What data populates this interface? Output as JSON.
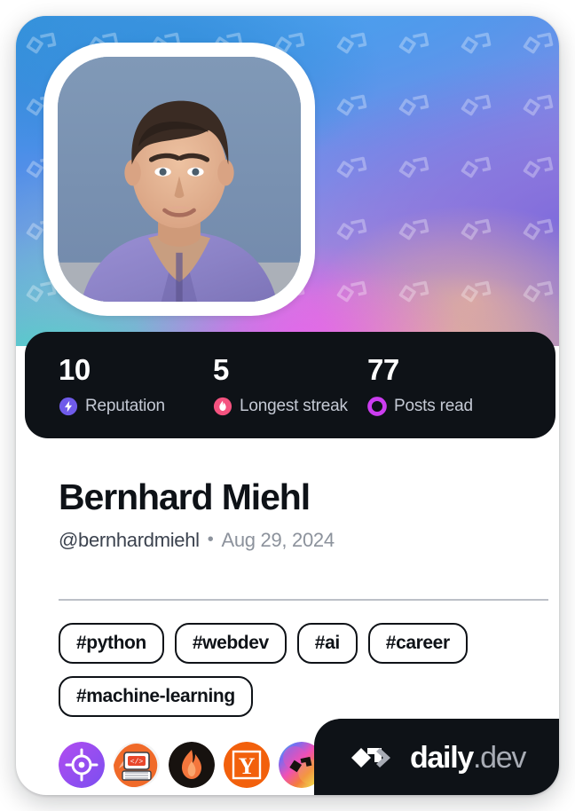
{
  "card": {
    "type": "developer-card",
    "accent_colors": {
      "reputation": "#6f5bea",
      "streak": "#f4527f",
      "posts_read": "#cc3df0",
      "card_dark": "#0e1217",
      "text_primary": "#0e1217",
      "text_muted": "#8c929c"
    }
  },
  "avatar": {
    "alt": "Bernhard Miehl profile photo",
    "shirt_color": "#8d86c9",
    "backdrop_color": "#7b94b4",
    "hair_color": "#3a2b23",
    "skin_color": "#e4b495"
  },
  "stats": [
    {
      "value": "10",
      "label": "Reputation",
      "icon": "bolt-icon",
      "color": "#6f5bea"
    },
    {
      "value": "5",
      "label": "Longest streak",
      "icon": "flame-icon",
      "color": "#f4527f"
    },
    {
      "value": "77",
      "label": "Posts read",
      "icon": "ring-icon",
      "color": "#cc3df0"
    }
  ],
  "identity": {
    "name": "Bernhard Miehl",
    "handle": "@bernhardmiehl",
    "separator": "•",
    "joined": "Aug 29, 2024"
  },
  "tags": [
    {
      "label": "#python"
    },
    {
      "label": "#webdev"
    },
    {
      "label": "#ai"
    },
    {
      "label": "#career"
    },
    {
      "label": "#machine-learning"
    }
  ],
  "badges": [
    {
      "name": "target-badge",
      "title": "target"
    },
    {
      "name": "devto-badge",
      "title": "dev computer"
    },
    {
      "name": "flame-badge",
      "title": "flame"
    },
    {
      "name": "hackernews-badge",
      "title": "Y",
      "letter": "Y"
    },
    {
      "name": "dailydev-badge",
      "title": "daily.dev"
    }
  ],
  "logo": {
    "mark": "dailydev-chevron-icon",
    "name_primary": "daily",
    "name_suffix": ".dev"
  }
}
